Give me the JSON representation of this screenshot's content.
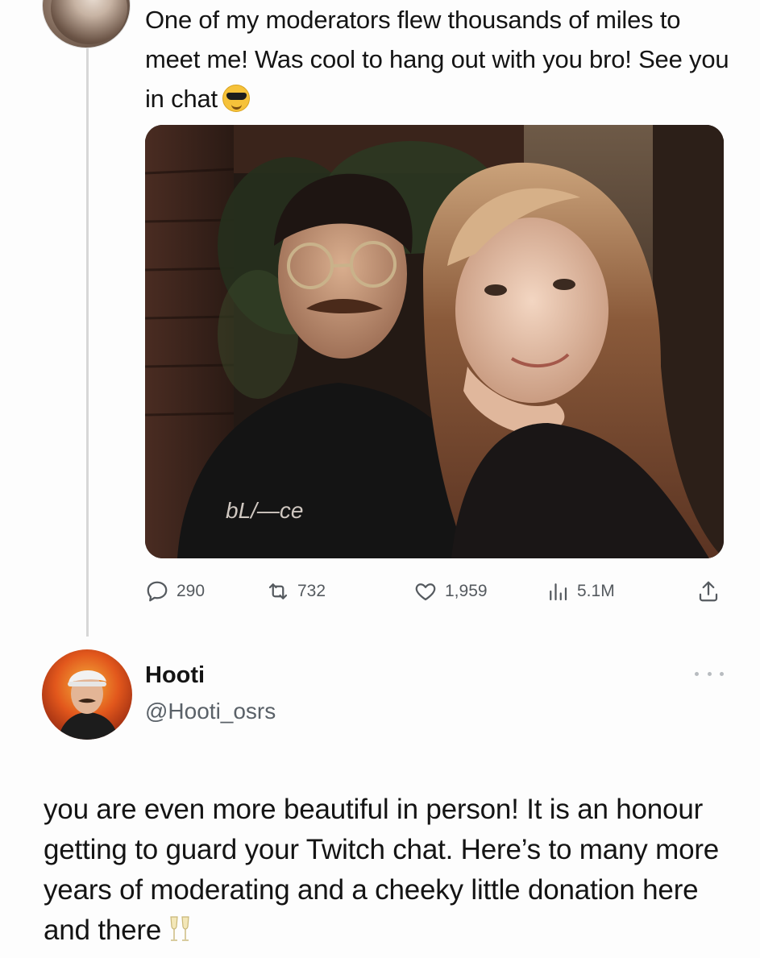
{
  "tweet": {
    "text": "One of my moderators flew thousands of miles to meet me! Was cool to hang out with you bro! See you in chat",
    "emoji": "smiling-face-with-sunglasses",
    "image": {
      "description_icon": "photo-of-two-people",
      "shirt_logo_text": "bL/—ce"
    },
    "stats": {
      "replies": "290",
      "reposts": "732",
      "likes": "1,959",
      "views": "5.1M"
    }
  },
  "reply": {
    "name": "Hooti",
    "handle": "@Hooti_osrs",
    "text": "you are even more beautiful in person! It is an honour getting to guard your Twitch chat. Here’s to many more years of moderating and a cheeky little donation here and there",
    "emoji": "clinking-glasses"
  },
  "colors": {
    "text": "#141414",
    "secondary_text": "#555a5f",
    "thread_line": "#d7d7d7"
  }
}
